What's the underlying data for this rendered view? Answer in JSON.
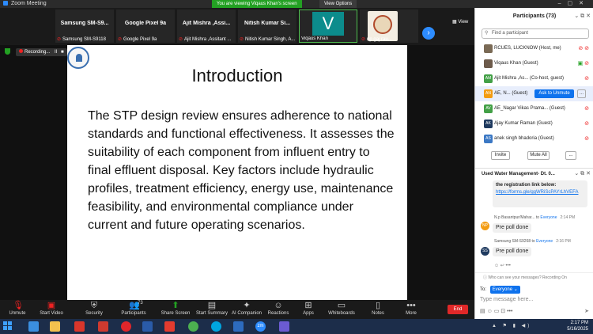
{
  "window": {
    "title": "Zoom Meeting"
  },
  "banner": {
    "viewing": "You are viewing Viqaus Khan's screen",
    "view_options": "View Options"
  },
  "thumbnails": [
    {
      "name": "Samsung  SM-S9...",
      "footer": "Samsung SM-S9118"
    },
    {
      "name": "Google Pixel 9a",
      "footer": "Google Pixel 9a"
    },
    {
      "name": "Ajit Mishra ,Assi...",
      "footer": "Ajit Mishra ,Assitant ..."
    },
    {
      "name": "Nitish Kumar Si...",
      "footer": "Nitish Kumar Singh, A..."
    },
    {
      "name": "",
      "footer": "Viqaus Khan",
      "avatar": "V"
    },
    {
      "name": "",
      "footer": "np gaj rau..."
    }
  ],
  "view_label": "View",
  "recording": {
    "label": "Recording...",
    "pause": "II",
    "stop": "■"
  },
  "slide": {
    "title": "Introduction",
    "body": "The STP design review ensures adherence to national standards and functional effectiveness. It assesses the suitability of each component from influent entry to final effluent disposal. Key factors include hydraulic profiles, treatment efficiency, energy use, maintenance feasibility, and environmental compliance under current and future operating scenarios."
  },
  "toolbar": {
    "unmute": "Unmute",
    "start_video": "Start Video",
    "security": "Security",
    "participants": "Participants",
    "participants_count": "73",
    "share_screen": "Share Screen",
    "start_summary": "Start Summary",
    "ai_companion": "AI Companion",
    "reactions": "Reactions",
    "apps": "Apps",
    "whiteboards": "Whiteboards",
    "notes": "Notes",
    "more": "More",
    "end": "End"
  },
  "participants_panel": {
    "title": "Participants (73)",
    "search_placeholder": "Find a participant",
    "items": [
      {
        "initials": "",
        "name": "RCUES, LUCKNOW (Host, me)",
        "color": "#7a6a55"
      },
      {
        "initials": "",
        "name": "Viqaus Khan (Guest)",
        "color": "#6d5b4b"
      },
      {
        "initials": "AM",
        "name": "Ajit Mishra ,As... (Co-host, guest)",
        "color": "#43a047"
      },
      {
        "initials": "AN",
        "name": "AE, N...  (Guest)",
        "color": "#f39c12"
      },
      {
        "initials": "AV",
        "name": "AE_Nagar Vikas Prama...  (Guest)",
        "color": "#43a047"
      },
      {
        "initials": "AK",
        "name": "Ajay Kumar Raman (Guest)",
        "color": "#1f3a5f"
      },
      {
        "initials": "AS",
        "name": "anek singh bhadoria (Guest)",
        "color": "#3b78c4"
      }
    ],
    "ask_to_unmute": "Ask to Unmute",
    "more": "...",
    "invite": "Invite",
    "mute_all": "Mute All",
    "more_actions": "..."
  },
  "chat": {
    "title": "Used Water Management-  Dt. 0...",
    "link_message": {
      "text": "the registration link below:",
      "link": "https://forms.gle/ggWRiScPAYrLhVEFA"
    },
    "messages": [
      {
        "initials": "NP",
        "sender": "N.p Basantpur/Mahar...",
        "to_label": "to",
        "to": "Everyone",
        "time": "2:14 PM",
        "text": "Pre poll done",
        "color": "#f39c12"
      },
      {
        "initials": "SS",
        "sender": "Samsung SM-S9268",
        "to_label": "to",
        "to": "Everyone",
        "time": "2:16 PM",
        "text": "Pre poll done",
        "color": "#1f3a5f"
      }
    ],
    "who_can_see": "Who can see your messages? Recording On",
    "to_label": "To:",
    "recipient": "Everyone",
    "input_placeholder": "Type message here..."
  },
  "taskbar": {
    "time": "2:17 PM",
    "date": "5/16/2025",
    "zoom_label": "zm"
  }
}
